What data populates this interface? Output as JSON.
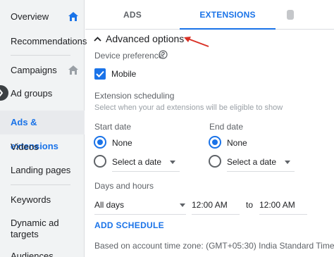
{
  "sidebar": {
    "items": [
      {
        "label": "Overview"
      },
      {
        "label": "Recommendations"
      },
      {
        "label": "Campaigns"
      },
      {
        "label": "Ad groups"
      },
      {
        "label": "Ads & extensions"
      },
      {
        "label": "Videos"
      },
      {
        "label": "Landing pages"
      },
      {
        "label": "Keywords"
      },
      {
        "label": "Dynamic ad targets"
      },
      {
        "label": "Audiences"
      }
    ],
    "active_item": "Ads & extensions"
  },
  "tabs": [
    {
      "label": "ADS"
    },
    {
      "label": "EXTENSIONS"
    }
  ],
  "active_tab": "EXTENSIONS",
  "advanced": {
    "title": "Advanced options",
    "device_label": "Device preference",
    "mobile_label": "Mobile",
    "mobile_checked": true,
    "scheduling_label": "Extension scheduling",
    "scheduling_hint": "Select when your ad extensions will be eligible to show",
    "start_date": {
      "label": "Start date",
      "none": "None",
      "select": "Select a date",
      "selected": "None"
    },
    "end_date": {
      "label": "End date",
      "none": "None",
      "select": "Select a date",
      "selected": "None"
    },
    "days_hours_label": "Days and hours",
    "days_value": "All days",
    "from_time": "12:00 AM",
    "to_label": "to",
    "to_time": "12:00 AM",
    "add_schedule": "ADD SCHEDULE",
    "timezone_note": "Based on account time zone: (GMT+05:30) India Standard Time"
  },
  "colors": {
    "accent": "#1a73e8",
    "annotation_arrow": "#d93025",
    "sidebar_bg": "#f1f3f4"
  }
}
